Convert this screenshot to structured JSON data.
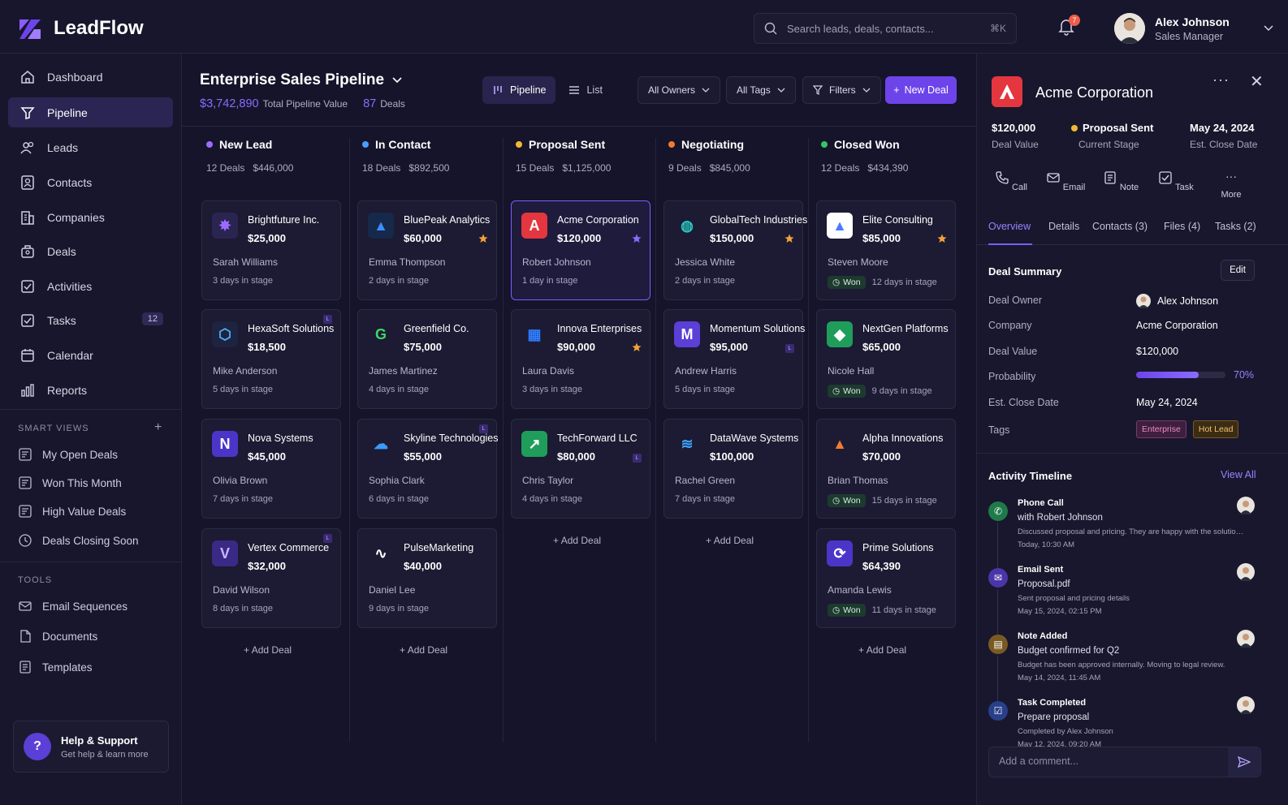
{
  "app": {
    "name": "LeadFlow"
  },
  "search": {
    "placeholder": "Search leads, deals, contacts...",
    "shortcut": "⌘K"
  },
  "notifications": {
    "count": "7"
  },
  "user": {
    "name": "Alex Johnson",
    "role": "Sales Manager"
  },
  "sidebar": {
    "items": [
      {
        "label": "Dashboard",
        "icon": "home-icon"
      },
      {
        "label": "Pipeline",
        "icon": "funnel-icon",
        "active": true
      },
      {
        "label": "Leads",
        "icon": "users-icon"
      },
      {
        "label": "Contacts",
        "icon": "contact-card-icon"
      },
      {
        "label": "Companies",
        "icon": "building-icon"
      },
      {
        "label": "Deals",
        "icon": "briefcase-icon"
      },
      {
        "label": "Activities",
        "icon": "activity-icon"
      },
      {
        "label": "Tasks",
        "icon": "checkbox-icon",
        "badge": "12"
      },
      {
        "label": "Calendar",
        "icon": "calendar-icon"
      },
      {
        "label": "Reports",
        "icon": "bar-chart-icon"
      }
    ],
    "smart_views_label": "SMART VIEWS",
    "smart_views": [
      "My Open Deals",
      "Won This Month",
      "High Value Deals",
      "Deals Closing Soon"
    ],
    "tools_label": "TOOLS",
    "tools": [
      "Email Sequences",
      "Documents",
      "Templates"
    ],
    "help": {
      "title": "Help & Support",
      "subtitle": "Get help & learn more"
    }
  },
  "header": {
    "title": "Enterprise Sales Pipeline",
    "total_value": "$3,742,890",
    "total_label": "Total Pipeline Value",
    "deal_count": "87",
    "deal_label": "Deals",
    "view_pipeline": "Pipeline",
    "view_list": "List",
    "owners": "All Owners",
    "tags": "All Tags",
    "filters": "Filters",
    "new_deal": "New Deal"
  },
  "columns": [
    {
      "name": "New Lead",
      "color": "#9b6cff",
      "count": "12 Deals",
      "total": "$446,000",
      "add": "Add Deal",
      "cards": [
        {
          "name": "Brightfuture Inc.",
          "value": "$25,000",
          "person": "Sarah Williams",
          "days": "3 days in stage",
          "logo_bg": "#2a2550",
          "logo_color": "#9b6cff",
          "glyph": "✸"
        },
        {
          "name": "HexaSoft Solutions",
          "value": "$18,500",
          "person": "Mike Anderson",
          "days": "5 days in stage",
          "logo_bg": "#1e2340",
          "logo_color": "#4fb4ff",
          "glyph": "⬡",
          "label_badge": "L"
        },
        {
          "name": "Nova Systems",
          "value": "$45,000",
          "person": "Olivia Brown",
          "days": "7 days in stage",
          "logo_bg": "#4b35c9",
          "logo_color": "#ffffff",
          "glyph": "N"
        },
        {
          "name": "Vertex Commerce",
          "value": "$32,000",
          "person": "David Wilson",
          "days": "8 days in stage",
          "logo_bg": "#3a2a86",
          "logo_color": "#c7b8ff",
          "glyph": "V",
          "label_badge": "L"
        }
      ]
    },
    {
      "name": "In Contact",
      "color": "#4a9dff",
      "count": "18 Deals",
      "total": "$892,500",
      "add": "Add Deal",
      "cards": [
        {
          "name": "BluePeak Analytics",
          "value": "$60,000",
          "person": "Emma Thompson",
          "days": "2 days in stage",
          "logo_bg": "#17294a",
          "logo_color": "#3d8cff",
          "glyph": "▲",
          "star": true
        },
        {
          "name": "Greenfield Co.",
          "value": "$75,000",
          "person": "James Martinez",
          "days": "4 days in stage",
          "logo_bg": "#1c1b33",
          "logo_color": "#3fd66a",
          "glyph": "G"
        },
        {
          "name": "Skyline Technologies",
          "value": "$55,000",
          "person": "Sophia Clark",
          "days": "6 days in stage",
          "logo_bg": "#1c1b33",
          "logo_color": "#3a9bff",
          "glyph": "☁",
          "label_badge": "L"
        },
        {
          "name": "PulseMarketing",
          "value": "$40,000",
          "person": "Daniel Lee",
          "days": "9 days in stage",
          "logo_bg": "#1c1b33",
          "logo_color": "#ffffff",
          "glyph": "∿"
        }
      ]
    },
    {
      "name": "Proposal Sent",
      "color": "#f2b92f",
      "count": "15 Deals",
      "total": "$1,125,000",
      "add": "Add Deal",
      "cards": [
        {
          "name": "Acme Corporation",
          "value": "$120,000",
          "person": "Robert Johnson",
          "days": "1 day in stage",
          "logo_bg": "#e3363e",
          "logo_color": "#ffffff",
          "glyph": "A",
          "star": true,
          "star_color": "#8a6cff",
          "selected": true
        },
        {
          "name": "Innova Enterprises",
          "value": "$90,000",
          "person": "Laura Davis",
          "days": "3 days in stage",
          "logo_bg": "#1c1b33",
          "logo_color": "#2f7dff",
          "glyph": "▦",
          "star": true
        },
        {
          "name": "TechForward LLC",
          "value": "$80,000",
          "person": "Chris Taylor",
          "days": "4 days in stage",
          "logo_bg": "#1f9d5b",
          "logo_color": "#ffffff",
          "glyph": "↗",
          "label_badge": "L",
          "badge_low": true
        }
      ]
    },
    {
      "name": "Negotiating",
      "color": "#f07c2f",
      "count": "9 Deals",
      "total": "$845,000",
      "add": "Add Deal",
      "cards": [
        {
          "name": "GlobalTech Industries",
          "value": "$150,000",
          "person": "Jessica White",
          "days": "2 days in stage",
          "logo_bg": "#1c1b33",
          "logo_color": "#29c8c0",
          "glyph": "◍",
          "star": true
        },
        {
          "name": "Momentum Solutions",
          "value": "$95,000",
          "person": "Andrew Harris",
          "days": "5 days in stage",
          "logo_bg": "#5b3fd6",
          "logo_color": "#ffffff",
          "glyph": "M",
          "label_badge": "L",
          "badge_low": true
        },
        {
          "name": "DataWave Systems",
          "value": "$100,000",
          "person": "Rachel Green",
          "days": "7 days in stage",
          "logo_bg": "#1c1b33",
          "logo_color": "#3fa3ff",
          "glyph": "≋"
        }
      ]
    },
    {
      "name": "Closed Won",
      "color": "#34c46a",
      "count": "12 Deals",
      "total": "$434,390",
      "add": "Add Deal",
      "cards": [
        {
          "name": "Elite Consulting",
          "value": "$85,000",
          "person": "Steven Moore",
          "days": "12 days in stage",
          "logo_bg": "#ffffff",
          "logo_color": "#4a7bff",
          "glyph": "▲",
          "star": true,
          "won": "Won"
        },
        {
          "name": "NextGen Platforms",
          "value": "$65,000",
          "person": "Nicole Hall",
          "days": "9 days in stage",
          "logo_bg": "#1f9d5b",
          "logo_color": "#ffffff",
          "glyph": "◆",
          "won": "Won"
        },
        {
          "name": "Alpha Innovations",
          "value": "$70,000",
          "person": "Brian Thomas",
          "days": "15 days in stage",
          "logo_bg": "#1c1b33",
          "logo_color": "#f07c2f",
          "glyph": "▲",
          "won": "Won"
        },
        {
          "name": "Prime Solutions",
          "value": "$64,390",
          "person": "Amanda Lewis",
          "days": "11 days in stage",
          "logo_bg": "#4b35c9",
          "logo_color": "#ffffff",
          "glyph": "⟳",
          "won": "Won"
        }
      ]
    }
  ],
  "detail": {
    "title": "Acme Corporation",
    "deal_value": "$120,000",
    "deal_value_label": "Deal Value",
    "stage": "Proposal Sent",
    "stage_label": "Current Stage",
    "stage_color": "#f2b92f",
    "close_date": "May 24, 2024",
    "close_date_label": "Est. Close Date",
    "actions": [
      "Call",
      "Email",
      "Note",
      "Task",
      "More"
    ],
    "tabs": [
      "Overview",
      "Details",
      "Contacts (3)",
      "Files (4)",
      "Tasks (2)"
    ],
    "summary_title": "Deal Summary",
    "edit": "Edit",
    "fields": {
      "owner_label": "Deal Owner",
      "owner": "Alex Johnson",
      "company_label": "Company",
      "company": "Acme Corporation",
      "value_label": "Deal Value",
      "value": "$120,000",
      "prob_label": "Probability",
      "prob": "70%",
      "prob_value": 0.7,
      "close_label": "Est. Close Date",
      "close": "May 24, 2024",
      "tags_label": "Tags",
      "tags": [
        "Enterprise",
        "Hot Lead"
      ]
    },
    "timeline_title": "Activity Timeline",
    "view_all": "View All",
    "timeline": [
      {
        "title": "Phone Call",
        "sub": "with Robert Johnson",
        "desc": "Discussed proposal and pricing. They are happy with the solution...",
        "time": "Today, 10:30 AM",
        "icon": "phone-icon",
        "color": "#1f7a4a"
      },
      {
        "title": "Email Sent",
        "sub": "Proposal.pdf",
        "desc": "Sent proposal and pricing details",
        "time": "May 15, 2024, 02:15 PM",
        "icon": "mail-icon",
        "color": "#4b35a8"
      },
      {
        "title": "Note Added",
        "sub": "Budget confirmed for Q2",
        "desc": "Budget has been approved internally. Moving to legal review.",
        "time": "May 14, 2024, 11:45 AM",
        "icon": "note-icon",
        "color": "#7a5a22"
      },
      {
        "title": "Task Completed",
        "sub": "Prepare proposal",
        "desc": "Completed by Alex Johnson",
        "time": "May 12, 2024, 09:20 AM",
        "icon": "task-icon",
        "color": "#2a3f8a"
      }
    ],
    "comment_placeholder": "Add a comment..."
  }
}
